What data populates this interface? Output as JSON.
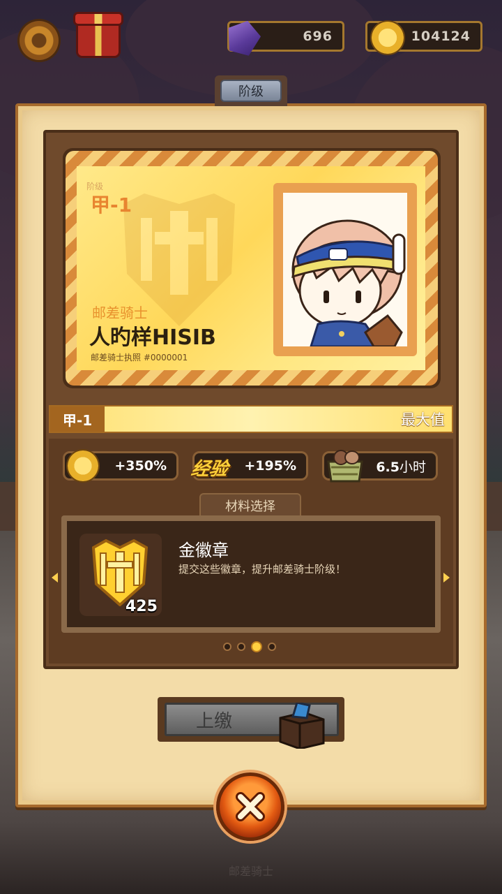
{
  "hud": {
    "gems": "696",
    "coins": "104124",
    "settings_icon": "gear-icon",
    "gift_icon": "gift-icon",
    "gem_icon": "purple-gem-icon",
    "coin_icon": "gold-coin-icon"
  },
  "panel": {
    "title": "阶级"
  },
  "license_card": {
    "rank_label": "阶级",
    "rank": "甲-1",
    "role": "邮差骑士",
    "player_name": "人旳样HISIB",
    "license_number": "邮差骑士执照 #0000001",
    "emblem_icon": "knight-shield-emblem",
    "portrait": "postman-knight-portrait"
  },
  "rank_bar": {
    "rank": "甲-1",
    "status": "最大值",
    "progress": 1.0
  },
  "bonuses": [
    {
      "icon": "gold-coin-icon",
      "value": "+350%"
    },
    {
      "icon_text": "经验",
      "value": "+195%"
    },
    {
      "icon": "crate-icon",
      "value": "6.5",
      "unit": "小时"
    }
  ],
  "materials": {
    "tab_label": "材料选择",
    "item_name": "金徽章",
    "item_description": "提交这些徽章，提升邮差骑士阶级！",
    "item_count": "425",
    "item_icon": "gold-badge-icon",
    "page_count": 4,
    "active_page": 3
  },
  "actions": {
    "submit_label": "上缴",
    "submit_icon": "submission-box-icon",
    "close_icon": "close-x-icon"
  },
  "footer": {
    "label": "邮差骑士"
  },
  "colors": {
    "panel_bg": "#f3dca8",
    "card_gold": "#ffd85a",
    "rank_orange": "#e88530",
    "close_orange": "#e25a12"
  }
}
